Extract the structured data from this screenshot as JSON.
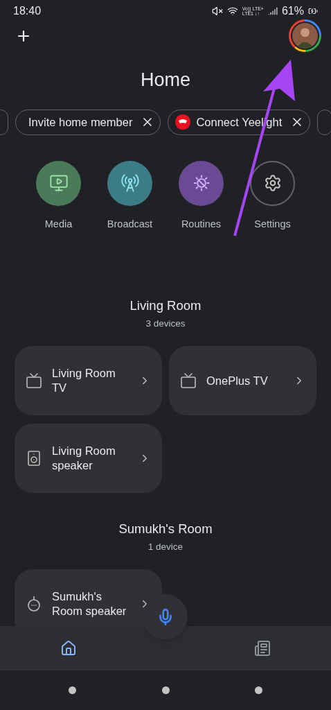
{
  "status_bar": {
    "time": "18:40",
    "network_labels": [
      "Vo)) LTE+",
      "LTE1 ↓↑"
    ],
    "battery": "61%"
  },
  "header": {
    "title": "Home"
  },
  "chips": [
    {
      "kind": "edge"
    },
    {
      "kind": "chip",
      "label": "Invite home member"
    },
    {
      "kind": "brand",
      "label": "Connect Yeelight"
    },
    {
      "kind": "edge"
    }
  ],
  "actions": [
    {
      "kind": "media",
      "label": "Media",
      "color": "#4a7a58"
    },
    {
      "kind": "broadcast",
      "label": "Broadcast",
      "color": "#3b7c86"
    },
    {
      "kind": "routines",
      "label": "Routines",
      "color": "#6b4a94"
    },
    {
      "kind": "settings",
      "label": "Settings"
    }
  ],
  "rooms": [
    {
      "name": "Living Room",
      "count": "3 devices",
      "devices": [
        {
          "kind": "tv",
          "name": "Living Room TV"
        },
        {
          "kind": "tv",
          "name": "OnePlus TV"
        },
        {
          "kind": "speaker",
          "name": "Living Room speaker"
        }
      ]
    },
    {
      "name": "Sumukh's Room",
      "count": "1 device",
      "devices": [
        {
          "kind": "smart-speaker",
          "name": "Sumukh's Room speaker"
        }
      ]
    }
  ],
  "nav_tabs": [
    {
      "kind": "home",
      "selected": true
    },
    {
      "kind": "feed",
      "selected": false
    }
  ]
}
